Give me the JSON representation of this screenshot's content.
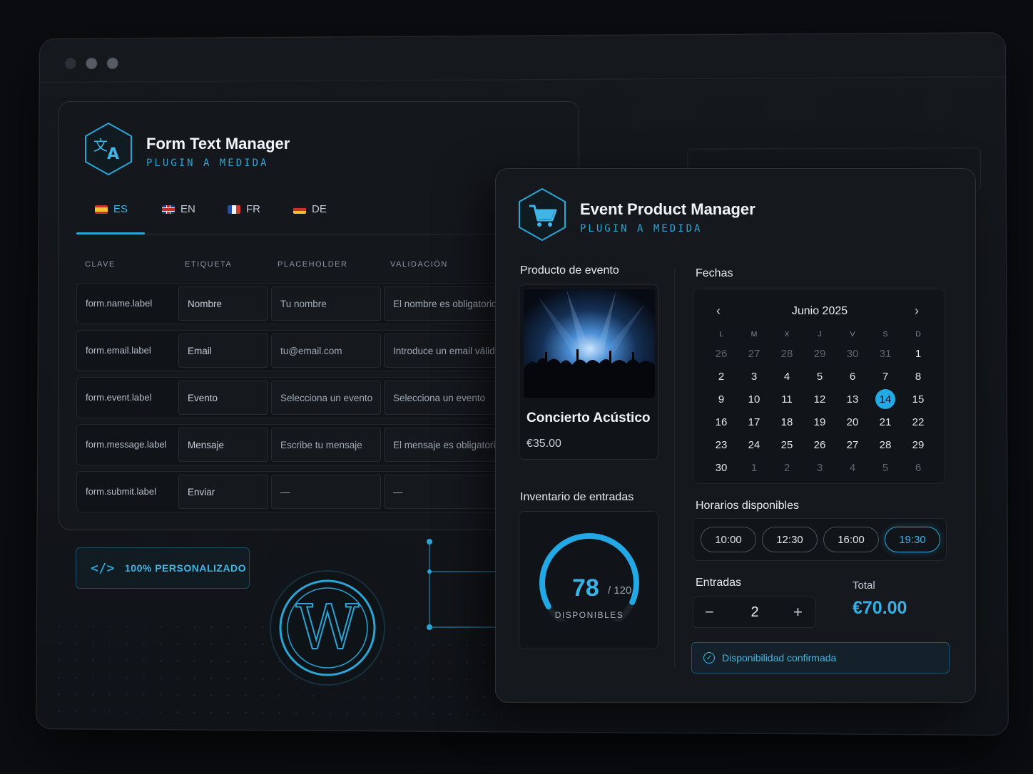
{
  "form_text_manager": {
    "title": "Form Text Manager",
    "subtitle": "PLUGIN A MEDIDA",
    "icon": "translate-icon",
    "tabs": [
      {
        "code": "ES",
        "flag": "flag-es",
        "active": true
      },
      {
        "code": "EN",
        "flag": "flag-en",
        "active": false
      },
      {
        "code": "FR",
        "flag": "flag-fr",
        "active": false
      },
      {
        "code": "DE",
        "flag": "flag-de",
        "active": false
      }
    ],
    "columns": [
      "CLAVE",
      "ETIQUETA",
      "PLACEHOLDER",
      "VALIDACIÓN"
    ],
    "rows": [
      {
        "key": "form.name.label",
        "label": "Nombre",
        "placeholder": "Tu nombre",
        "validation": "El nombre es obligatorio"
      },
      {
        "key": "form.email.label",
        "label": "Email",
        "placeholder": "tu@email.com",
        "validation": "Introduce un email válido"
      },
      {
        "key": "form.event.label",
        "label": "Evento",
        "placeholder": "Selecciona un evento",
        "validation": "Selecciona un evento"
      },
      {
        "key": "form.message.label",
        "label": "Mensaje",
        "placeholder": "Escribe tu mensaje",
        "validation": "El mensaje es obligatorio"
      },
      {
        "key": "form.submit.label",
        "label": "Enviar",
        "placeholder": "—",
        "validation": "—"
      }
    ]
  },
  "badge": {
    "label": "100% PERSONALIZADO",
    "icon": "code-icon"
  },
  "event_product_manager": {
    "title": "Event Product Manager",
    "subtitle": "PLUGIN A MEDIDA",
    "icon": "cart-icon",
    "product_section": "Producto de evento",
    "product": {
      "name": "Concierto Acústico",
      "price": "€35.00"
    },
    "inventory_section": "Inventario de entradas",
    "inventory": {
      "available": "78",
      "total": "/ 120",
      "label": "DISPONIBLES",
      "fraction": 0.65
    },
    "dates_section": "Fechas",
    "calendar": {
      "month": "Junio 2025",
      "weekdays": [
        "L",
        "M",
        "X",
        "J",
        "V",
        "S",
        "D"
      ],
      "days": [
        [
          "26",
          "27",
          "28",
          "29",
          "30",
          "31",
          "1"
        ],
        [
          "2",
          "3",
          "4",
          "5",
          "6",
          "7",
          "8"
        ],
        [
          "9",
          "10",
          "11",
          "12",
          "13",
          "14",
          "15"
        ],
        [
          "16",
          "17",
          "18",
          "19",
          "20",
          "21",
          "22"
        ],
        [
          "23",
          "24",
          "25",
          "26",
          "27",
          "28",
          "29"
        ],
        [
          "30",
          "1",
          "2",
          "3",
          "4",
          "5",
          "6"
        ]
      ],
      "selected": "14"
    },
    "slots_section": "Horarios disponibles",
    "slots": [
      "10:00",
      "12:30",
      "16:00",
      "19:30"
    ],
    "active_slot": "19:30",
    "tickets_label": "Entradas",
    "tickets_value": "2",
    "total_label": "Total",
    "total_value": "€70.00",
    "confirmation": "Disponibilidad confirmada"
  },
  "colors": {
    "accent": "#2aa5d6",
    "background": "#0a0c10",
    "panel": "#14171c"
  }
}
